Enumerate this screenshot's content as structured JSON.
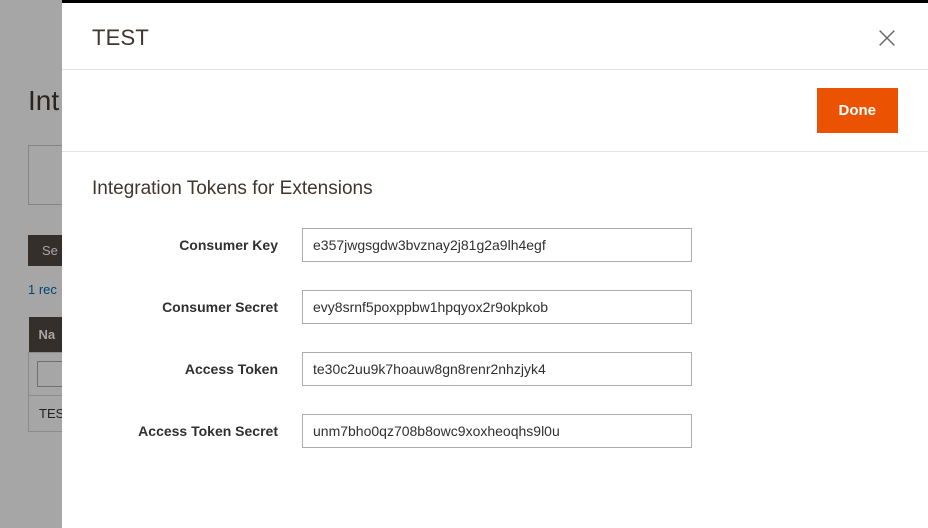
{
  "background": {
    "page_title_truncated": "Int",
    "search_btn_truncated": "Se",
    "records_truncated": "1 rec",
    "col_name_truncated": "Na",
    "cell_test": "TES"
  },
  "modal": {
    "title": "TEST",
    "done_label": "Done",
    "section_title": "Integration Tokens for Extensions",
    "fields": {
      "consumer_key": {
        "label": "Consumer Key",
        "value": "e357jwgsgdw3bvznay2j81g2a9lh4egf"
      },
      "consumer_secret": {
        "label": "Consumer Secret",
        "value": "evy8srnf5poxppbw1hpqyox2r9okpkob"
      },
      "access_token": {
        "label": "Access Token",
        "value": "te30c2uu9k7hoauw8gn8renr2nhzjyk4"
      },
      "access_token_secret": {
        "label": "Access Token Secret",
        "value": "unm7bho0qz708b8owc9xoxheoqhs9l0u"
      }
    }
  }
}
